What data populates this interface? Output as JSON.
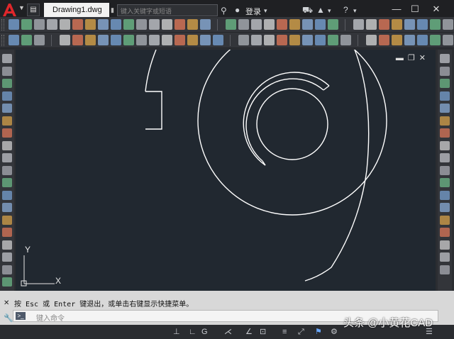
{
  "titlebar": {
    "doc_tab_title": "Drawing1.dwg",
    "search_placeholder": "键入关键字或短语",
    "login_label": "登录"
  },
  "drawing": {
    "ucs_y_label": "Y",
    "ucs_x_label": "X"
  },
  "command": {
    "history_text": "按 Esc 或 Enter 键退出，或单击右键显示快捷菜单。",
    "input_placeholder": "键入命令"
  },
  "watermark": {
    "text": "头条 @小黄花CAD"
  },
  "colors": {
    "drawing_bg": "#212830",
    "geometry_stroke": "#ffffff",
    "app_accent": "#e0272b"
  }
}
